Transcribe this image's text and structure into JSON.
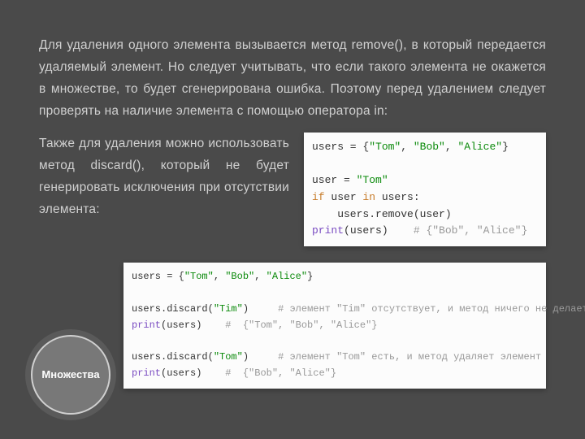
{
  "para1": "Для удаления одного элемента вызывается метод remove(), в который передается удаляемый элемент. Но следует учитывать, что если такого элемента не окажется в множестве, то будет сгенерирована ошибка. Поэтому перед удалением следует проверять на наличие элемента с помощью оператора in:",
  "para2": "Также для удаления можно использовать метод discard(), который не будет генерировать исключения при отсутствии элемента:",
  "code1": {
    "l1a": "users = {",
    "l1b": "\"Tom\"",
    "l1c": ", ",
    "l1d": "\"Bob\"",
    "l1e": ", ",
    "l1f": "\"Alice\"",
    "l1g": "}",
    "l2": "",
    "l3a": "user = ",
    "l3b": "\"Tom\"",
    "l4a": "if",
    "l4b": " user ",
    "l4c": "in",
    "l4d": " users:",
    "l5": "    users.remove(user)",
    "l6a": "print",
    "l6b": "(users)    ",
    "l6c": "# {\"Bob\", \"Alice\"}"
  },
  "code2": {
    "l1a": "users = {",
    "l1b": "\"Tom\"",
    "l1c": ", ",
    "l1d": "\"Bob\"",
    "l1e": ", ",
    "l1f": "\"Alice\"",
    "l1g": "}",
    "l2": "",
    "l3a": "users.discard(",
    "l3b": "\"Tim\"",
    "l3c": ")     ",
    "l3d": "# элемент \"Tim\" отсутствует, и метод ничего не делает",
    "l4a": "print",
    "l4b": "(users)    ",
    "l4c": "#  {\"Tom\", \"Bob\", \"Alice\"}",
    "l5": "",
    "l6a": "users.discard(",
    "l6b": "\"Tom\"",
    "l6c": ")     ",
    "l6d": "# элемент \"Tom\" есть, и метод удаляет элемент",
    "l7a": "print",
    "l7b": "(users)    ",
    "l7c": "#  {\"Bob\", \"Alice\"}"
  },
  "badge": "Множества"
}
